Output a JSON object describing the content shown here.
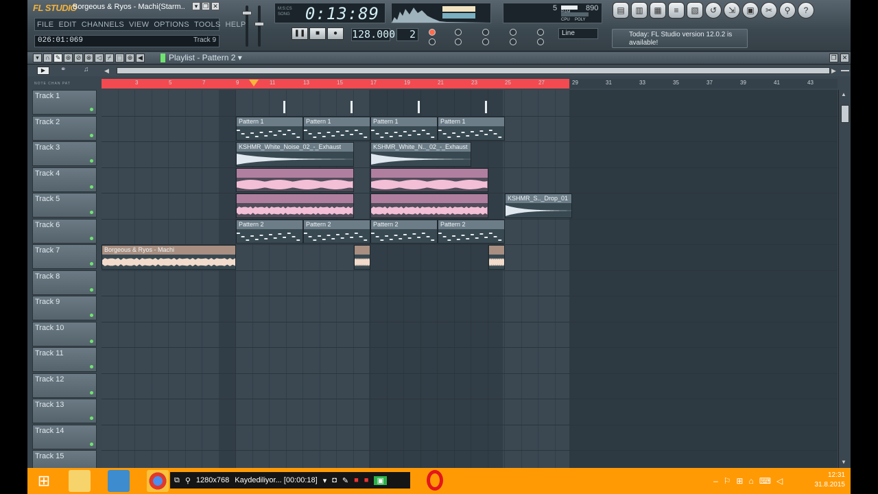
{
  "app": {
    "logo": "FL STUDIO",
    "window_title": "Borgeous & Ryos - Machi(Starm..",
    "window_buttons": [
      "▾",
      "❐",
      "✕"
    ]
  },
  "menu": [
    "FILE",
    "EDIT",
    "CHANNELS",
    "VIEW",
    "OPTIONS",
    "TOOLS",
    "HELP"
  ],
  "hint_bar": {
    "position": "026:01:069",
    "target": "Track 9"
  },
  "time_display": {
    "value": "0:13:89",
    "labels": [
      "M:S:CS",
      "SONG"
    ]
  },
  "transport": {
    "pause": "❚❚",
    "stop": "■",
    "record": "●"
  },
  "tempo": "128.000",
  "pattern_number": "2",
  "cpu": {
    "value": "5",
    "ram": "890",
    "labels": [
      "RAM",
      "CPU",
      "POLY"
    ]
  },
  "snap": "Line",
  "news": "Today: FL Studio version 12.0.2 is available!",
  "toolbar_icons": [
    "playlist-icon",
    "piano-roll-icon",
    "step-sequencer-icon",
    "mixer-icon",
    "browser-icon",
    "undo-icon",
    "render-icon",
    "save-icon",
    "tools-icon",
    "search-icon",
    "help-icon"
  ],
  "playlist": {
    "title": "Playlist - Pattern 2 ▾",
    "tracks": [
      "Track 1",
      "Track 2",
      "Track 3",
      "Track 4",
      "Track 5",
      "Track 6",
      "Track 7",
      "Track 8",
      "Track 9",
      "Track 10",
      "Track 11",
      "Track 12",
      "Track 13",
      "Track 14",
      "Track 15"
    ],
    "ruler_labels": [
      "3",
      "5",
      "7",
      "9",
      "11",
      "13",
      "15",
      "17",
      "19",
      "21",
      "23",
      "25",
      "27",
      "29",
      "31",
      "33",
      "35",
      "37",
      "39",
      "41",
      "43"
    ],
    "clips": {
      "pattern1": "Pattern 1",
      "pattern2": "Pattern 2",
      "white_noise_a": "KSHMR_White_Noise_02_-_Exhaust",
      "white_noise_b": "KSHMR_White_N.._02_-_Exhaust",
      "drop": "KSHMR_S.._Drop_01",
      "main_audio": "Borgeous & Ryos - Machi"
    }
  },
  "taskbar": {
    "resolution": "1280x768",
    "recording": "Kaydediliyor... [00:00:18]",
    "clock": "12:31",
    "date": "31.8.2015"
  },
  "colors": {
    "accent_orange": "#f2b33d",
    "taskbar": "#ff9a05",
    "ruler_red": "#f24a50"
  }
}
